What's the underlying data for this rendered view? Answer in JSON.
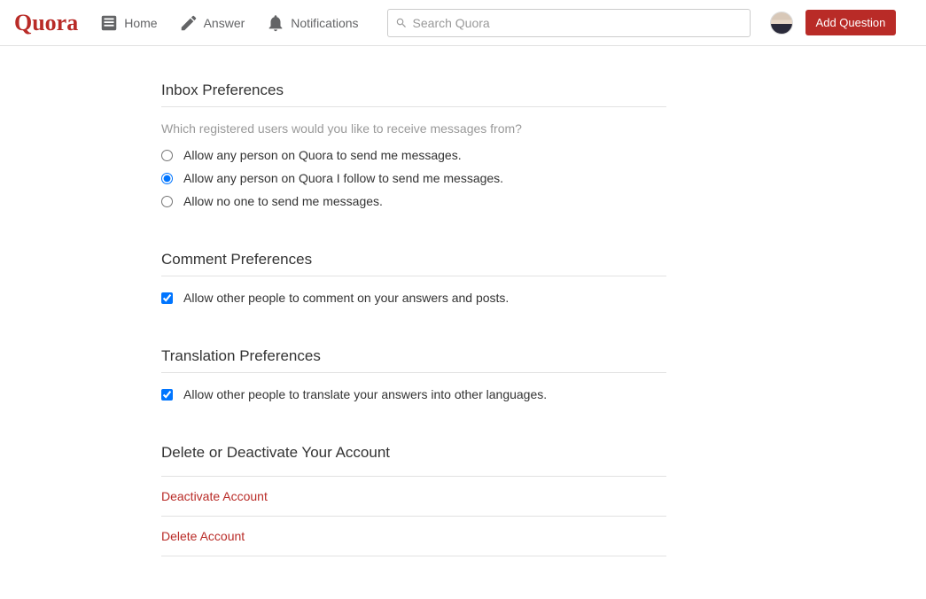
{
  "header": {
    "logo": "Quora",
    "nav": {
      "home": "Home",
      "answer": "Answer",
      "notifications": "Notifications"
    },
    "search_placeholder": "Search Quora",
    "add_question": "Add Question"
  },
  "sections": {
    "inbox": {
      "title": "Inbox Preferences",
      "desc": "Which registered users would you like to receive messages from?",
      "options": {
        "opt1": "Allow any person on Quora to send me messages.",
        "opt2": "Allow any person on Quora I follow to send me messages.",
        "opt3": "Allow no one to send me messages."
      }
    },
    "comment": {
      "title": "Comment Preferences",
      "opt": "Allow other people to comment on your answers and posts."
    },
    "translation": {
      "title": "Translation Preferences",
      "opt": "Allow other people to translate your answers into other languages."
    },
    "delete": {
      "title": "Delete or Deactivate Your Account",
      "deactivate": "Deactivate Account",
      "delete_link": "Delete Account"
    }
  }
}
